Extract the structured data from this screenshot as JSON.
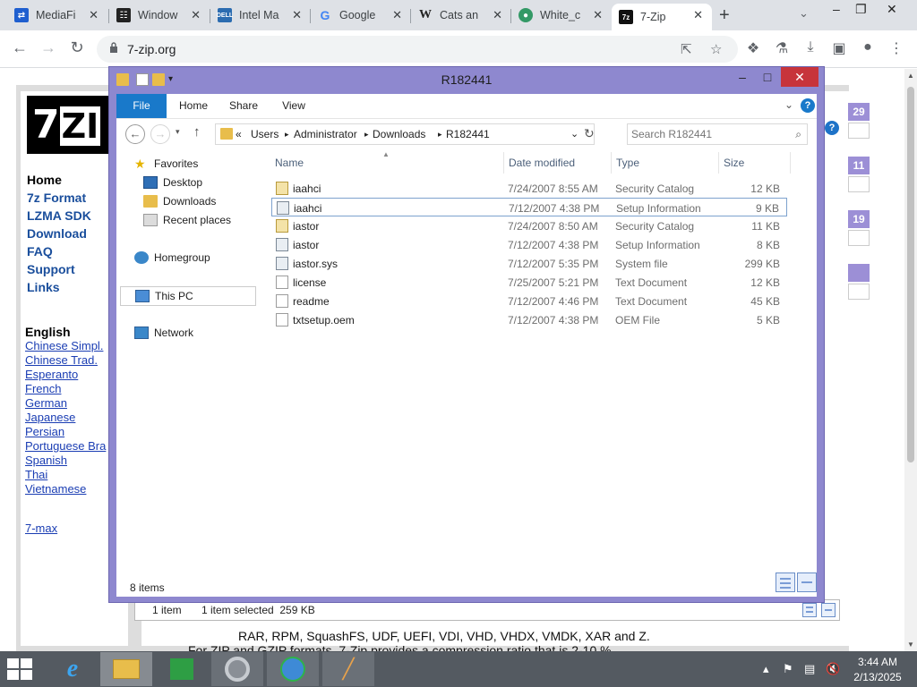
{
  "browser": {
    "tabs": [
      {
        "label": "MediaFi",
        "icon": "mediafire-icon"
      },
      {
        "label": "Window",
        "icon": "archive-icon"
      },
      {
        "label": "Intel Ma",
        "icon": "dell-icon"
      },
      {
        "label": "Google",
        "icon": "google-icon"
      },
      {
        "label": "Cats an",
        "icon": "wikipedia-icon"
      },
      {
        "label": "White_c",
        "icon": "wikimedia-icon"
      },
      {
        "label": "7-Zip",
        "icon": "7zip-icon"
      }
    ],
    "url": "7-zip.org"
  },
  "webpage": {
    "logo": "7ZIP",
    "nav": [
      "Home",
      "7z Format",
      "LZMA SDK",
      "Download",
      "FAQ",
      "Support",
      "Links"
    ],
    "languages_heading": "English",
    "languages": [
      "Chinese Simpl.",
      "Chinese Trad.",
      "Esperanto",
      "French",
      "German",
      "Japanese",
      "Persian",
      "Portuguese Bra",
      "Spanish",
      "Thai",
      "Vietnamese"
    ],
    "seven_max": "7-max",
    "right_badges": [
      "29",
      "11",
      "19"
    ],
    "text_line": "RAR, RPM, SquashFS, UDF, UEFI, VDI, VHD, VHDX, VMDK, XAR and Z.",
    "bullet_line": "For ZIP and GZIP formats, 7-Zip provides a compression ratio that is 2-10 %"
  },
  "back_window_status": {
    "items": "1 item",
    "selected": "1 item selected  259 KB"
  },
  "explorer": {
    "title": "R182441",
    "ribbon_tabs": [
      "File",
      "Home",
      "Share",
      "View"
    ],
    "breadcrumb": [
      "«",
      "Users",
      "Administrator",
      "Downloads",
      "R182441"
    ],
    "search_placeholder": "Search R182441",
    "nav_pane": {
      "favorites": "Favorites",
      "desktop": "Desktop",
      "downloads": "Downloads",
      "recent": "Recent places",
      "homegroup": "Homegroup",
      "thispc": "This PC",
      "network": "Network"
    },
    "columns": [
      "Name",
      "Date modified",
      "Type",
      "Size"
    ],
    "files": [
      {
        "name": "iaahci",
        "date": "7/24/2007 8:55 AM",
        "type": "Security Catalog",
        "size": "12 KB",
        "icon": "cat"
      },
      {
        "name": "iaahci",
        "date": "7/12/2007 4:38 PM",
        "type": "Setup Information",
        "size": "9 KB",
        "icon": "gear"
      },
      {
        "name": "iastor",
        "date": "7/24/2007 8:50 AM",
        "type": "Security Catalog",
        "size": "11 KB",
        "icon": "cat"
      },
      {
        "name": "iastor",
        "date": "7/12/2007 4:38 PM",
        "type": "Setup Information",
        "size": "8 KB",
        "icon": "gear"
      },
      {
        "name": "iastor.sys",
        "date": "7/12/2007 5:35 PM",
        "type": "System file",
        "size": "299 KB",
        "icon": "gear"
      },
      {
        "name": "license",
        "date": "7/25/2007 5:21 PM",
        "type": "Text Document",
        "size": "12 KB",
        "icon": "doc"
      },
      {
        "name": "readme",
        "date": "7/12/2007 4:46 PM",
        "type": "Text Document",
        "size": "45 KB",
        "icon": "doc"
      },
      {
        "name": "txtsetup.oem",
        "date": "7/12/2007 4:38 PM",
        "type": "OEM File",
        "size": "5 KB",
        "icon": "doc"
      }
    ],
    "status": "8 items"
  },
  "taskbar": {
    "apps": [
      "internet-explorer-icon",
      "file-explorer-icon",
      "store-icon",
      "chrome-icon",
      "download-manager-icon",
      "app-icon"
    ],
    "time": "3:44 AM",
    "date": "2/13/2025"
  },
  "colors": {
    "explorer_frame": "#8e88cf",
    "file_tab": "#1979ca",
    "close_button": "#c7343b",
    "taskbar": "#545a61"
  }
}
